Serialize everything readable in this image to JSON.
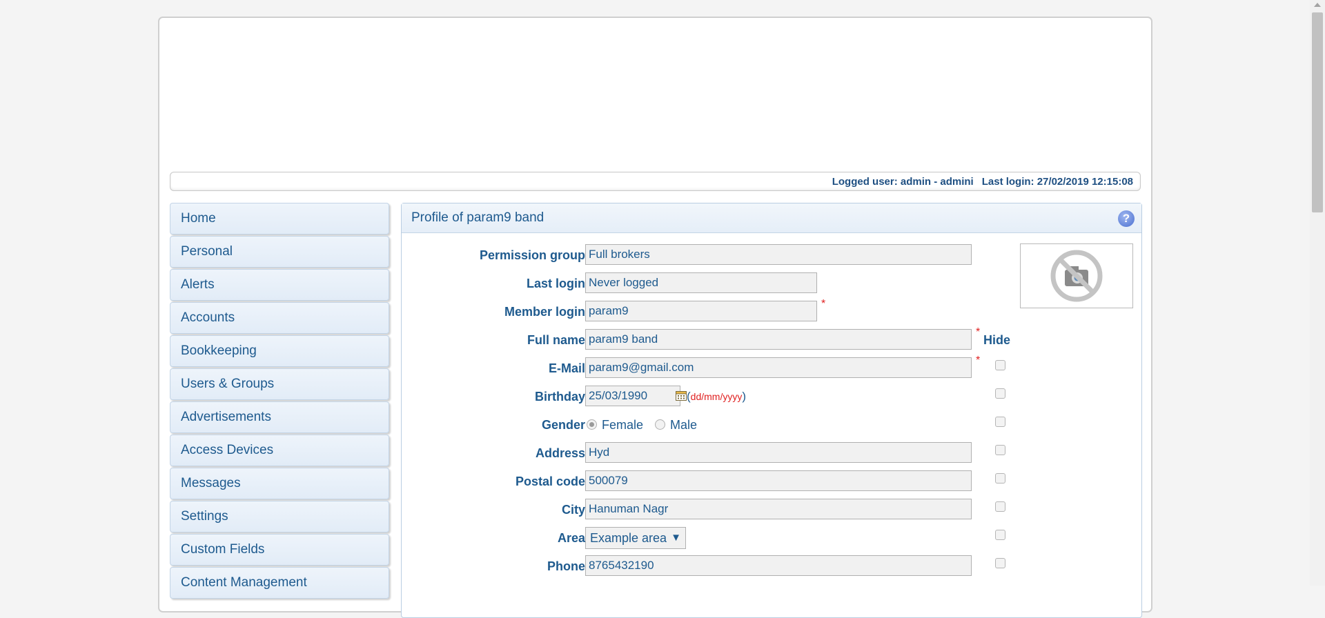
{
  "status": {
    "logged_user": "Logged user: admin - admini",
    "last_login": "Last login: 27/02/2019 12:15:08"
  },
  "sidebar": {
    "items": [
      {
        "label": "Home"
      },
      {
        "label": "Personal"
      },
      {
        "label": "Alerts"
      },
      {
        "label": "Accounts"
      },
      {
        "label": "Bookkeeping"
      },
      {
        "label": "Users & Groups"
      },
      {
        "label": "Advertisements"
      },
      {
        "label": "Access Devices"
      },
      {
        "label": "Messages"
      },
      {
        "label": "Settings"
      },
      {
        "label": "Custom Fields"
      },
      {
        "label": "Content Management"
      }
    ]
  },
  "profile": {
    "title": "Profile of param9 band",
    "help_icon": "?",
    "photo_icon": "no-photo-camera-icon",
    "hide_label": "Hide",
    "required_mark": "*",
    "fields": {
      "permission_group": {
        "label": "Permission group",
        "value": "Full brokers"
      },
      "last_login": {
        "label": "Last login",
        "value": "Never logged"
      },
      "member_login": {
        "label": "Member login",
        "value": "param9"
      },
      "full_name": {
        "label": "Full name",
        "value": "param9 band"
      },
      "email": {
        "label": "E-Mail",
        "value": "param9@gmail.com"
      },
      "birthday": {
        "label": "Birthday",
        "value": "25/03/1990",
        "format": "dd/mm/yyyy",
        "open_paren": "(",
        "close_paren": ")"
      },
      "gender": {
        "label": "Gender",
        "option_female": "Female",
        "option_male": "Male",
        "selected": "Female"
      },
      "address": {
        "label": "Address",
        "value": "Hyd"
      },
      "postal_code": {
        "label": "Postal code",
        "value": "500079"
      },
      "city": {
        "label": "City",
        "value": "Hanuman Nagr"
      },
      "area": {
        "label": "Area",
        "value": "Example area",
        "arrow": "▼"
      },
      "phone": {
        "label": "Phone",
        "value": "8765432190"
      }
    }
  },
  "colors": {
    "text_blue": "#1e5a8e",
    "required_red": "#e02020",
    "menu_bg": "#e8f0f9"
  }
}
